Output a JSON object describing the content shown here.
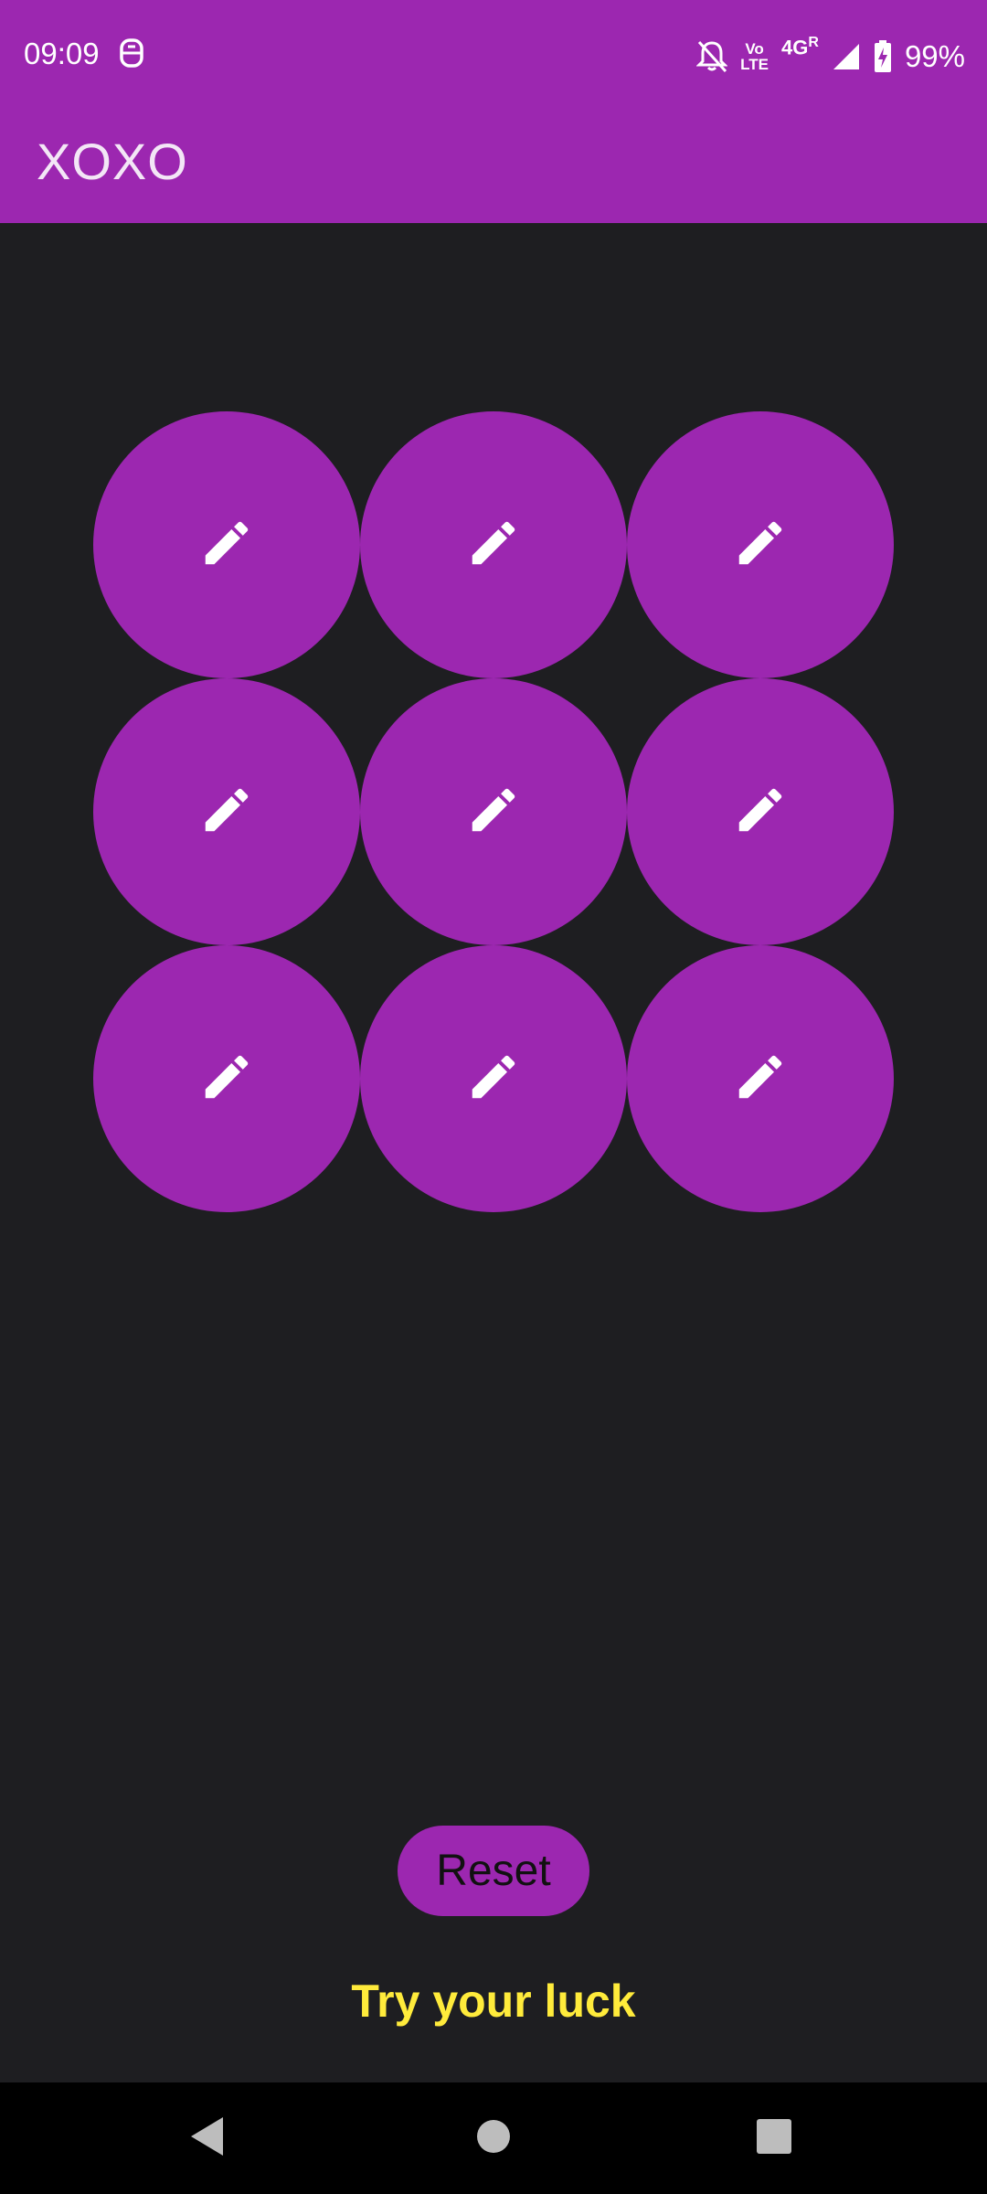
{
  "status_bar": {
    "time": "09:09",
    "volte_top": "Vo",
    "volte_bottom": "LTE",
    "network": "4G",
    "roaming": "R",
    "battery": "99%"
  },
  "app_bar": {
    "title": "XOXO"
  },
  "board": {
    "cells": [
      {
        "icon": "pencil-icon"
      },
      {
        "icon": "pencil-icon"
      },
      {
        "icon": "pencil-icon"
      },
      {
        "icon": "pencil-icon"
      },
      {
        "icon": "pencil-icon"
      },
      {
        "icon": "pencil-icon"
      },
      {
        "icon": "pencil-icon"
      },
      {
        "icon": "pencil-icon"
      },
      {
        "icon": "pencil-icon"
      }
    ]
  },
  "controls": {
    "reset_label": "Reset"
  },
  "message": "Try your luck",
  "colors": {
    "accent": "#9c27b0",
    "background": "#1e1e21",
    "message": "#ffeb3b",
    "nav_bar": "#000000"
  },
  "nav_bar": {
    "icons": [
      "back-icon",
      "home-icon",
      "recents-icon"
    ]
  }
}
